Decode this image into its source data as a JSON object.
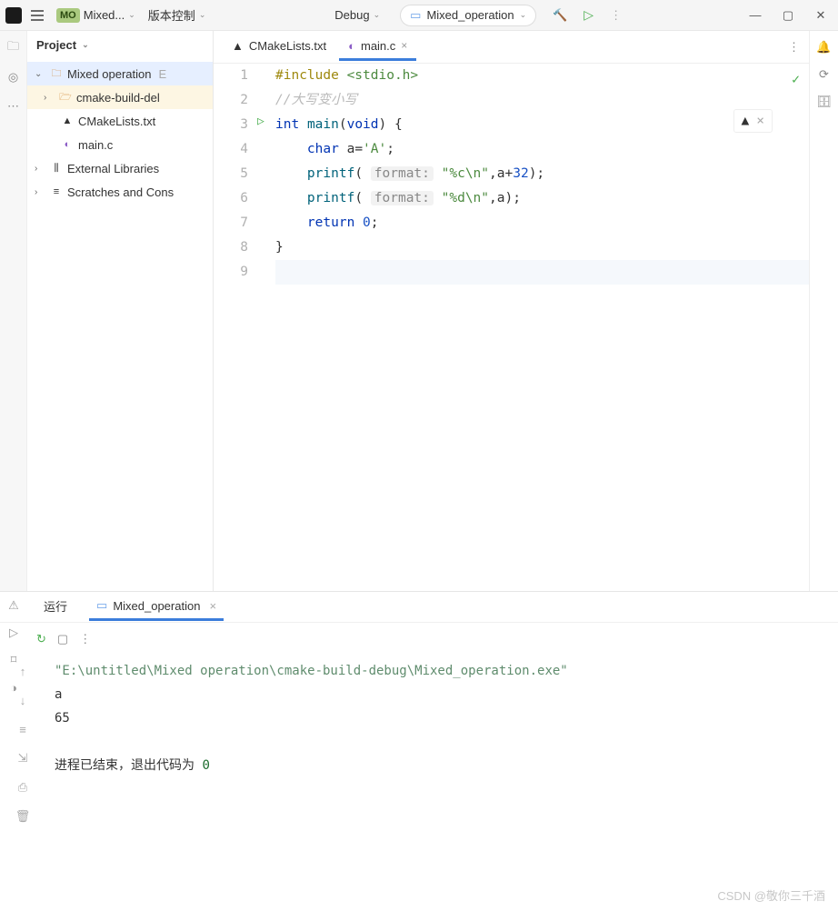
{
  "titlebar": {
    "project_short": "Mixed...",
    "project_badge": "MO",
    "vcs": "版本控制",
    "config": "Debug",
    "run_config": "Mixed_operation"
  },
  "project_panel": {
    "title": "Project",
    "tree": [
      {
        "label": "Mixed operation",
        "suffix": "E",
        "type": "root"
      },
      {
        "label": "cmake-build-del",
        "type": "folder-open"
      },
      {
        "label": "CMakeLists.txt",
        "type": "cmake"
      },
      {
        "label": "main.c",
        "type": "c"
      },
      {
        "label": "External Libraries",
        "type": "lib"
      },
      {
        "label": "Scratches and Cons",
        "type": "scratch"
      }
    ]
  },
  "tabs": [
    {
      "label": "CMakeLists.txt",
      "active": false
    },
    {
      "label": "main.c",
      "active": true
    }
  ],
  "code": {
    "lines": [
      {
        "n": 1,
        "html": "include"
      },
      {
        "n": 2,
        "html": "comment"
      },
      {
        "n": 3,
        "html": "main"
      },
      {
        "n": 4,
        "html": "decl"
      },
      {
        "n": 5,
        "html": "printf1"
      },
      {
        "n": 6,
        "html": "printf2"
      },
      {
        "n": 7,
        "html": "return"
      },
      {
        "n": 8,
        "html": "close"
      },
      {
        "n": 9,
        "html": ""
      }
    ],
    "include_kw": "#include",
    "include_hdr": "<stdio.h>",
    "comment": "//大写变小写",
    "int": "int",
    "main": "main",
    "void": "void",
    "char": "char",
    "var": "a",
    "charval": "'A'",
    "printf": "printf",
    "hint": "format:",
    "fmt1": "\"%c\\n\"",
    "fmt2": "\"%d\\n\"",
    "plus": "32",
    "return": "return",
    "zero": "0"
  },
  "run_panel": {
    "tab1": "运行",
    "tab2": "Mixed_operation",
    "console": {
      "path": "\"E:\\untitled\\Mixed operation\\cmake-build-debug\\Mixed_operation.exe\"",
      "out1": "a",
      "out2": "65",
      "exit_pre": "进程已结束，退出代码为 ",
      "exit_code": "0"
    }
  },
  "watermark": "CSDN @敬你三千酒"
}
